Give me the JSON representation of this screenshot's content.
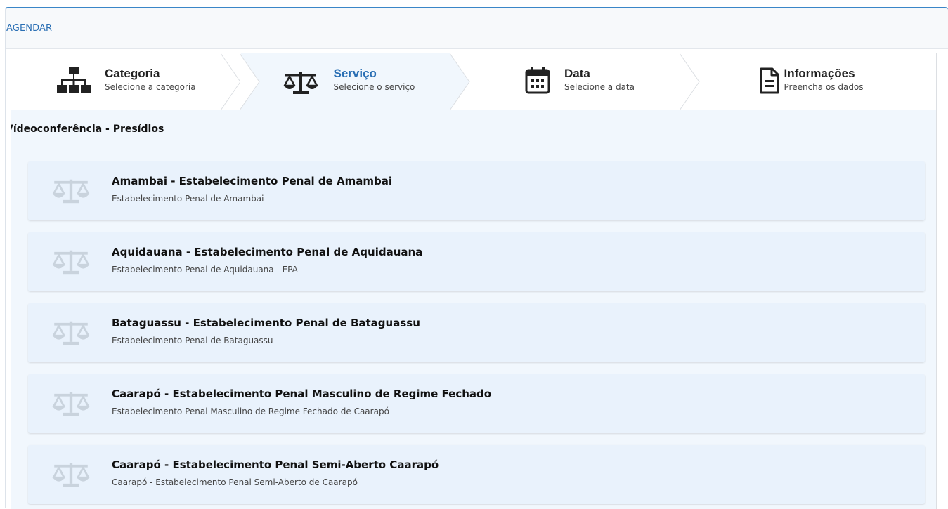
{
  "panel": {
    "title": "AGENDAR"
  },
  "steps": [
    {
      "title": "Categoria",
      "subtitle": "Selecione a categoria",
      "icon": "sitemap-icon",
      "active": false
    },
    {
      "title": "Serviço",
      "subtitle": "Selecione o serviço",
      "icon": "balance-scale-icon",
      "active": true
    },
    {
      "title": "Data",
      "subtitle": "Selecione a data",
      "icon": "calendar-icon",
      "active": false
    },
    {
      "title": "Informações",
      "subtitle": "Preencha os dados",
      "icon": "document-icon",
      "active": false
    }
  ],
  "section": {
    "title": "Vídeoconferência - Presídios"
  },
  "services": [
    {
      "title": "Amambai - Estabelecimento Penal de Amambai",
      "subtitle": "Estabelecimento Penal de Amambai",
      "icon": "balance-scale-icon"
    },
    {
      "title": "Aquidauana - Estabelecimento Penal de Aquidauana",
      "subtitle": "Estabelecimento Penal de Aquidauana - EPA",
      "icon": "balance-scale-icon"
    },
    {
      "title": "Bataguassu - Estabelecimento Penal de Bataguassu",
      "subtitle": "Estabelecimento Penal de Bataguassu",
      "icon": "balance-scale-icon"
    },
    {
      "title": "Caarapó - Estabelecimento Penal Masculino de Regime Fechado",
      "subtitle": "Estabelecimento Penal Masculino de Regime Fechado de Caarapó",
      "icon": "balance-scale-icon"
    },
    {
      "title": "Caarapó - Estabelecimento Penal Semi-Aberto Caarapó",
      "subtitle": "Caarapó - Estabelecimento Penal Semi-Aberto de Caarapó",
      "icon": "balance-scale-icon"
    }
  ],
  "colors": {
    "accent": "#2a6fb4",
    "panel_border": "#3a86c8",
    "card_bg": "#e9f2fc",
    "content_bg": "#f1f7fd"
  }
}
